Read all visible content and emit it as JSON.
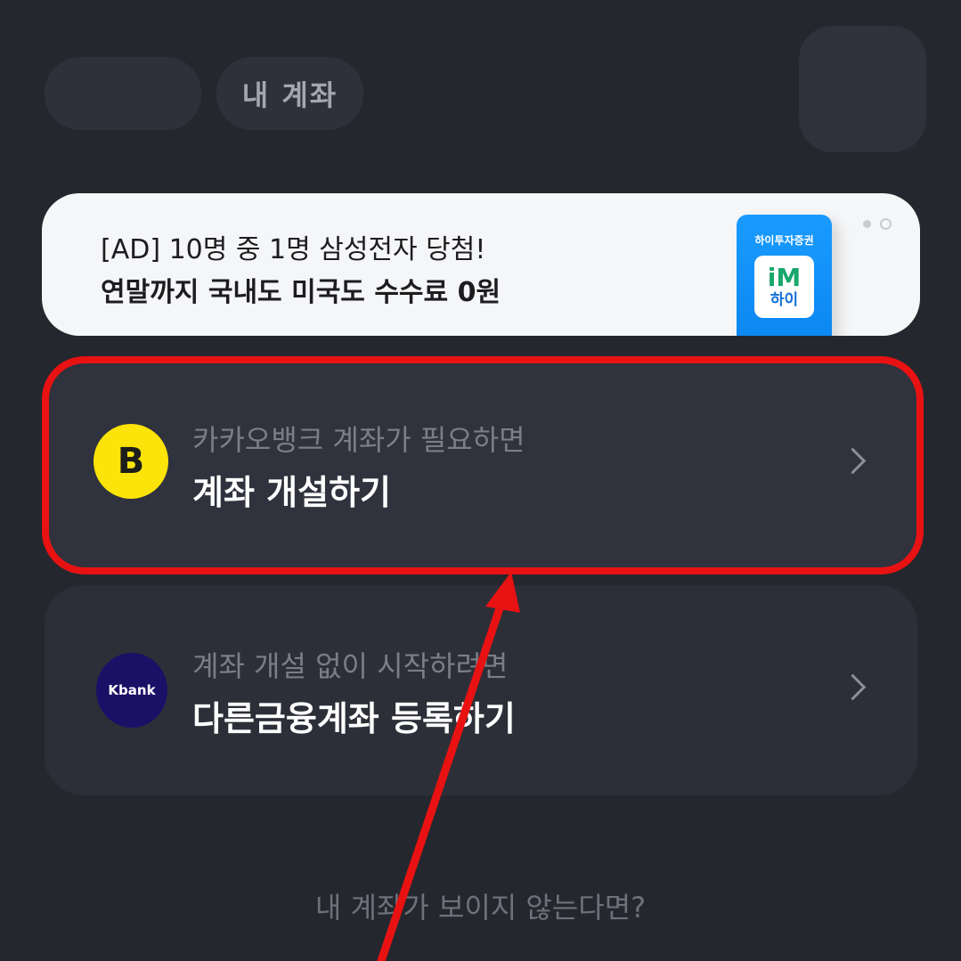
{
  "header": {
    "tabs": [
      {
        "label": ""
      },
      {
        "label": "내 계좌"
      }
    ]
  },
  "ad": {
    "line1": "[AD] 10명 중 1명 삼성전자 당첨!",
    "line2": "연말까지 국내도 미국도 수수료 0원",
    "phone_label": "하이투자증권",
    "logo_top": "iM",
    "logo_bottom": "하이"
  },
  "cards": [
    {
      "icon_text": "B",
      "subtitle": "카카오뱅크 계좌가 필요하면",
      "title": "계좌 개설하기"
    },
    {
      "icon_text": "Kbank",
      "subtitle": "계좌 개설 없이 시작하려면",
      "title": "다른금융계좌 등록하기"
    }
  ],
  "footer": {
    "link": "내 계좌가 보이지 않는다면?"
  },
  "colors": {
    "background": "#25272e",
    "kakao": "#fce40a",
    "kbank": "#1b1066",
    "annotation": "#e81212"
  }
}
